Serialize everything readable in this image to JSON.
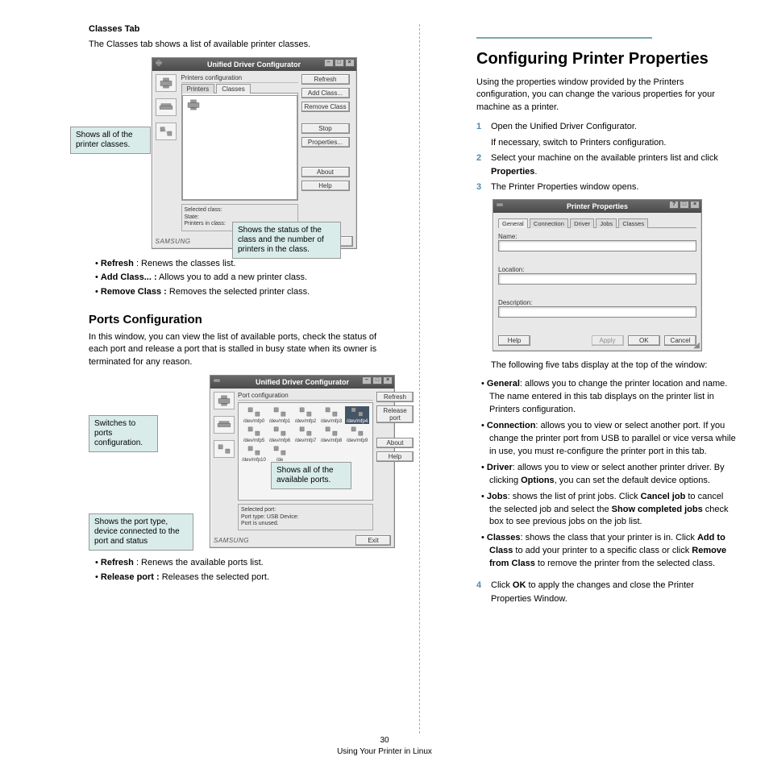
{
  "left": {
    "classes_tab_heading": "Classes Tab",
    "classes_intro": "The Classes tab shows a list of available printer classes.",
    "win_classes": {
      "title": "Unified Driver Configurator",
      "section": "Printers configuration",
      "tab_printers": "Printers",
      "tab_classes": "Classes",
      "btn_refresh": "Refresh",
      "btn_add": "Add Class...",
      "btn_remove": "Remove Class",
      "btn_stop": "Stop",
      "btn_properties": "Properties...",
      "btn_about": "About",
      "btn_help": "Help",
      "status_label": "Selected class:",
      "status_state": "State:",
      "status_printers": "Printers in class:",
      "brand": "SAMSUNG",
      "btn_exit": "Exit"
    },
    "callout_classes_list": "Shows all of the printer classes.",
    "callout_classes_status": "Shows the status of the class and the number of printers in the class.",
    "classes_bullets": {
      "refresh_label": "Refresh",
      "refresh_text": " : Renews the classes list.",
      "add_label": "Add Class... :",
      "add_text": " Allows you to add a new printer class.",
      "remove_label": "Remove Class :",
      "remove_text": " Removes the selected printer class."
    },
    "ports_heading": "Ports Configuration",
    "ports_intro": "In this window, you can view the list of available ports, check the status of each port and release a port that is stalled in busy state when its owner is terminated for any reason.",
    "win_ports": {
      "title": "Unified Driver Configurator",
      "section": "Port configuration",
      "btn_refresh": "Refresh",
      "btn_release": "Release port",
      "btn_about": "About",
      "btn_help": "Help",
      "row1": [
        "/dev/mfp0",
        "/dev/mfp1",
        "/dev/mfp2",
        "/dev/mfp3",
        "/dev/mfp4"
      ],
      "row2": [
        "/dev/mfp5",
        "/dev/mfp6",
        "/dev/mfp7",
        "/dev/mfp8",
        "/dev/mfp9"
      ],
      "row3": [
        "/dev/mfp10",
        "/de"
      ],
      "status_label": "Selected port:",
      "status_type": "Port type: USB   Device:",
      "status_state": "Port is unused.",
      "brand": "SAMSUNG",
      "btn_exit": "Exit"
    },
    "callout_ports_switch": "Switches to ports configuration.",
    "callout_ports_list": "Shows all of the available ports.",
    "callout_ports_status": "Shows the port type, device connected to the port and status",
    "ports_bullets": {
      "refresh_label": "Refresh",
      "refresh_text": " : Renews the available ports list.",
      "release_label": "Release port :",
      "release_text": " Releases the selected port."
    }
  },
  "right": {
    "title": "Configuring Printer Properties",
    "intro": "Using the properties window provided by the Printers configuration, you can change the various properties for your machine as a printer.",
    "steps": {
      "s1": "Open the Unified Driver Configurator.",
      "s1b": "If necessary, switch to Printers configuration.",
      "s2a": "Select your machine on the available printers list and click ",
      "s2b": "Properties",
      "s2c": ".",
      "s3": "The Printer Properties window opens."
    },
    "win_props": {
      "title": "Printer Properties",
      "tab_general": "General",
      "tab_connection": "Connection",
      "tab_driver": "Driver",
      "tab_jobs": "Jobs",
      "tab_classes": "Classes",
      "name": "Name:",
      "location": "Location:",
      "description": "Description:",
      "btn_help": "Help",
      "btn_apply": "Apply",
      "btn_ok": "OK",
      "btn_cancel": "Cancel"
    },
    "tabs_intro": "The following five tabs display at the top of the window:",
    "tab_desc": {
      "general_b": "General",
      "general": ": allows you to change the printer location and name. The name entered in this tab displays on the printer list in Printers configuration.",
      "connection_b": "Connection",
      "connection": ": allows you to view or select another port. If you change the printer port from USB to parallel or vice versa while in use, you must re-configure the printer port in this tab.",
      "driver_b": "Driver",
      "driver1": ": allows you to view or select another printer driver. By clicking ",
      "driver_opt": "Options",
      "driver2": ", you can set the default device options.",
      "jobs_b": "Jobs",
      "jobs1": ": shows the list of print jobs. Click ",
      "jobs_cancel": "Cancel job",
      "jobs2": " to cancel the selected job and select the ",
      "jobs_show": "Show completed jobs",
      "jobs3": " check box to see previous jobs on the job list.",
      "classes_b": "Classes",
      "classes1": ": shows the class that your printer is in. Click ",
      "classes_add": "Add to Class",
      "classes2": " to add your printer to a specific class or click ",
      "classes_remove": "Remove from Class",
      "classes3": " to remove the printer from the selected class."
    },
    "step4a": "Click ",
    "step4_ok": "OK",
    "step4b": " to apply the changes and close the Printer Properties Window."
  },
  "footer": {
    "page": "30",
    "caption": "Using Your Printer in Linux"
  }
}
